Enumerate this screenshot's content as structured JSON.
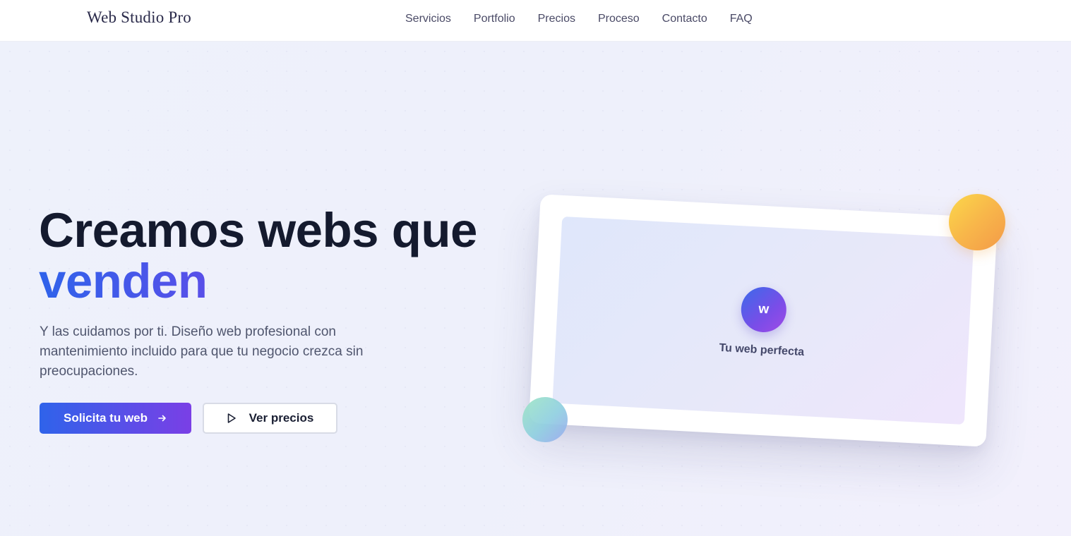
{
  "header": {
    "logo": "Web Studio Pro",
    "nav": [
      "Servicios",
      "Portfolio",
      "Precios",
      "Proceso",
      "Contacto",
      "FAQ"
    ]
  },
  "hero": {
    "title_line1": "Creamos webs que",
    "title_line2": "venden",
    "subtitle": "Y las cuidamos por ti. Diseño web profesional con mantenimiento incluido para que tu negocio crezca sin preocupaciones.",
    "primary_button": "Solicita tu web",
    "secondary_button": "Ver precios",
    "primary_icon": "arrow-right-icon",
    "secondary_icon": "play-icon"
  },
  "mockup": {
    "logo_letter": "w",
    "caption": "Tu web perfecta"
  },
  "colors": {
    "accent_blue": "#2f63ea",
    "accent_purple": "#8f3ae6",
    "heading": "#141a2e",
    "body_text": "#50566e",
    "background": "#eef1fb"
  }
}
